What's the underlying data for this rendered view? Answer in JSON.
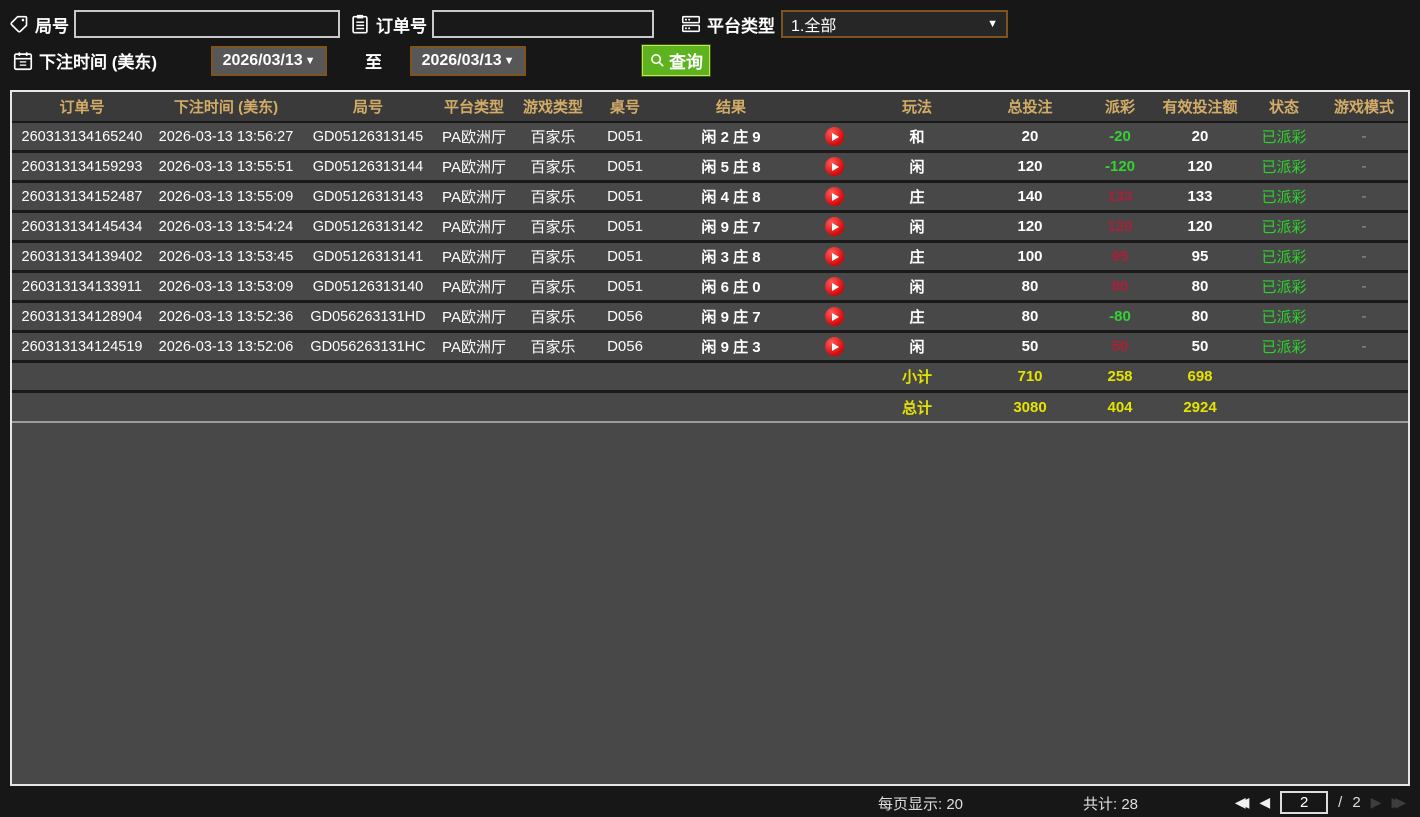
{
  "filters": {
    "game_no_label": "局号",
    "order_no_label": "订单号",
    "platform_label": "平台类型",
    "platform_value": "1.全部",
    "bet_time_label": "下注时间 (美东)",
    "date_from": "2026/03/13",
    "date_to": "2026/03/13",
    "to_label": "至",
    "search_label": "查询"
  },
  "table": {
    "headers": [
      "订单号",
      "下注时间 (美东)",
      "局号",
      "平台类型",
      "游戏类型",
      "桌号",
      "结果",
      "玩法",
      "总投注",
      "派彩",
      "有效投注额",
      "状态",
      "游戏模式"
    ],
    "rows": [
      {
        "order": "260313134165240",
        "time": "2026-03-13 13:56:27",
        "game_no": "GD05126313145",
        "platform": "PA欧洲厅",
        "game_type": "百家乐",
        "table_no": "D051",
        "result": "闲 2 庄 9",
        "play": "和",
        "total_bet": "20",
        "payout": "-20",
        "payout_sign": "neg",
        "valid_bet": "20",
        "status": "已派彩",
        "mode": "-"
      },
      {
        "order": "260313134159293",
        "time": "2026-03-13 13:55:51",
        "game_no": "GD05126313144",
        "platform": "PA欧洲厅",
        "game_type": "百家乐",
        "table_no": "D051",
        "result": "闲 5 庄 8",
        "play": "闲",
        "total_bet": "120",
        "payout": "-120",
        "payout_sign": "neg",
        "valid_bet": "120",
        "status": "已派彩",
        "mode": "-"
      },
      {
        "order": "260313134152487",
        "time": "2026-03-13 13:55:09",
        "game_no": "GD05126313143",
        "platform": "PA欧洲厅",
        "game_type": "百家乐",
        "table_no": "D051",
        "result": "闲 4 庄 8",
        "play": "庄",
        "total_bet": "140",
        "payout": "133",
        "payout_sign": "pos",
        "valid_bet": "133",
        "status": "已派彩",
        "mode": "-"
      },
      {
        "order": "260313134145434",
        "time": "2026-03-13 13:54:24",
        "game_no": "GD05126313142",
        "platform": "PA欧洲厅",
        "game_type": "百家乐",
        "table_no": "D051",
        "result": "闲 9 庄 7",
        "play": "闲",
        "total_bet": "120",
        "payout": "120",
        "payout_sign": "pos",
        "valid_bet": "120",
        "status": "已派彩",
        "mode": "-"
      },
      {
        "order": "260313134139402",
        "time": "2026-03-13 13:53:45",
        "game_no": "GD05126313141",
        "platform": "PA欧洲厅",
        "game_type": "百家乐",
        "table_no": "D051",
        "result": "闲 3 庄 8",
        "play": "庄",
        "total_bet": "100",
        "payout": "95",
        "payout_sign": "pos",
        "valid_bet": "95",
        "status": "已派彩",
        "mode": "-"
      },
      {
        "order": "260313134133911",
        "time": "2026-03-13 13:53:09",
        "game_no": "GD05126313140",
        "platform": "PA欧洲厅",
        "game_type": "百家乐",
        "table_no": "D051",
        "result": "闲 6 庄 0",
        "play": "闲",
        "total_bet": "80",
        "payout": "80",
        "payout_sign": "pos",
        "valid_bet": "80",
        "status": "已派彩",
        "mode": "-"
      },
      {
        "order": "260313134128904",
        "time": "2026-03-13 13:52:36",
        "game_no": "GD056263131HD",
        "platform": "PA欧洲厅",
        "game_type": "百家乐",
        "table_no": "D056",
        "result": "闲 9 庄 7",
        "play": "庄",
        "total_bet": "80",
        "payout": "-80",
        "payout_sign": "neg",
        "valid_bet": "80",
        "status": "已派彩",
        "mode": "-"
      },
      {
        "order": "260313134124519",
        "time": "2026-03-13 13:52:06",
        "game_no": "GD056263131HC",
        "platform": "PA欧洲厅",
        "game_type": "百家乐",
        "table_no": "D056",
        "result": "闲 9 庄 3",
        "play": "闲",
        "total_bet": "50",
        "payout": "50",
        "payout_sign": "pos",
        "valid_bet": "50",
        "status": "已派彩",
        "mode": "-"
      }
    ],
    "subtotal": {
      "label": "小计",
      "total_bet": "710",
      "payout": "258",
      "valid_bet": "698"
    },
    "total": {
      "label": "总计",
      "total_bet": "3080",
      "payout": "404",
      "valid_bet": "2924"
    }
  },
  "pagination": {
    "per_page_label": "每页显示: 20",
    "total_label": "共计: 28",
    "current_page": "2",
    "page_sep": "/",
    "total_pages": "2"
  },
  "colors": {
    "header_gold": "#d3ad68",
    "payout_pos": "#aa2038",
    "payout_neg": "#35d135",
    "status_green": "#2bd32b",
    "totals_yellow": "#e4e400",
    "button_green": "#5cb31e",
    "date_border_brown": "#7d5420"
  }
}
